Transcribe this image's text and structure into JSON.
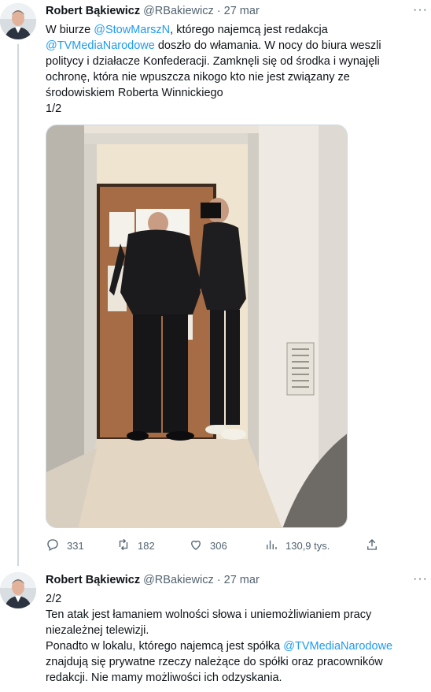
{
  "tweets": [
    {
      "author_name": "Robert Bąkiewicz",
      "handle": "@RBakiewicz",
      "separator": "·",
      "date": "27 mar",
      "more_label": "···",
      "text": {
        "l1_a": "W biurze ",
        "l1_mention": "@StowMarszN",
        "l1_b": ", którego najemcą jest redakcja",
        "l2_mention": "@TVMediaNarodowe",
        "l2_b": " doszło do włamania. W nocy do biura weszli",
        "l3": "politycy i działacze Konfederacji. Zamknęli się od środka i wynajęli",
        "l4": "ochronę, która nie wpuszcza nikogo kto nie jest związany ze",
        "l5": "środowiskiem Roberta Winnickiego",
        "l6": "1/2"
      },
      "stats": {
        "replies": "331",
        "retweets": "182",
        "likes": "306",
        "views": "130,9 tys."
      },
      "icons": [
        "reply-icon",
        "retweet-icon",
        "like-icon",
        "views-icon",
        "share-icon"
      ]
    },
    {
      "author_name": "Robert Bąkiewicz",
      "handle": "@RBakiewicz",
      "separator": "·",
      "date": "27 mar",
      "more_label": "···",
      "text": {
        "l1": "2/2",
        "l2": "Ten atak jest łamaniem wolności słowa i uniemożliwianiem pracy",
        "l3": "niezależnej telewizji.",
        "l4_a": "Ponadto w lokalu, którego najemcą jest spółka ",
        "l4_mention": "@TVMediaNarodowe",
        "l5": "znajdują się prywatne rzeczy należące do spółki oraz pracowników",
        "l6": "redakcji. Nie mamy możliwości ich odzyskania."
      }
    }
  ],
  "colors": {
    "link": "#1d9bf0",
    "secondary_text": "#536471",
    "primary_text": "#0f1419",
    "thread_line": "#cfd9de"
  }
}
